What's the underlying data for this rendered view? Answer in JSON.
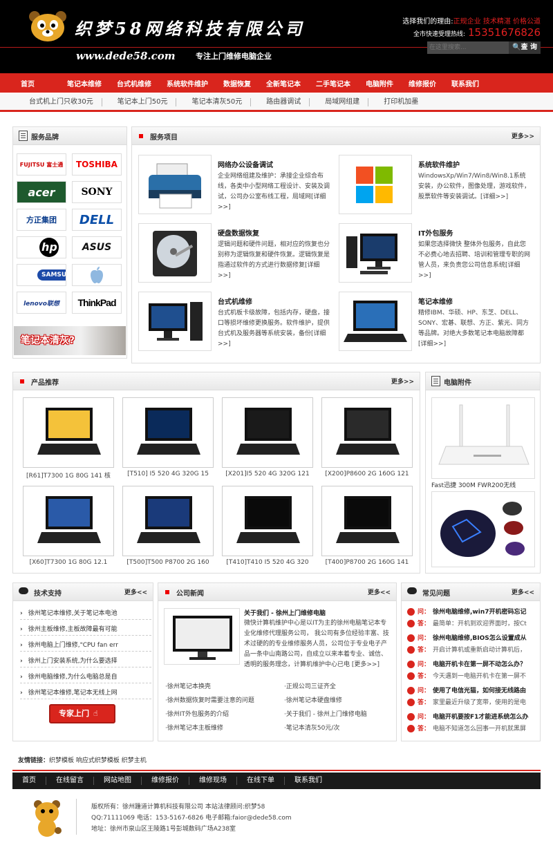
{
  "header": {
    "company": "织梦58网络科技有限公司",
    "url": "www.dede58.com",
    "slogan": "专注上门维修电脑企业",
    "why_label": "选择我们的理由:",
    "why_items": "正规企业 技术精湛 价格公道",
    "hotline_label": "全市快速受理热线:",
    "hotline": "15351676826",
    "search_placeholder": "在这里搜索...",
    "search_button": "查 询"
  },
  "nav": [
    "首页",
    "笔记本维修",
    "台式机维修",
    "系统软件维护",
    "数据恢复",
    "全新笔记本",
    "二手笔记本",
    "电脑附件",
    "维修报价",
    "联系我们"
  ],
  "subnav": [
    "台式机上门只收30元",
    "笔记本上门50元",
    "笔记本清灰50元",
    "路由器调试",
    "局域网组建",
    "打印机加墨"
  ],
  "brands": {
    "title": "服务品牌",
    "items": [
      "FUJITSU 富士通",
      "TOSHIBA",
      "acer",
      "SONY",
      "方正集团",
      "DELL",
      "hp",
      "ASUS",
      "SAMSUNG",
      "Apple",
      "lenovo联想",
      "ThinkPad"
    ],
    "banner": "笔记本清灰?"
  },
  "services": {
    "title": "服务项目",
    "more": "更多>>",
    "items": [
      {
        "title": "网络办公设备调试",
        "desc": "企业网络组建及维护：承接企业综合布线，各类中小型网络工程设计、安装及调试，公司办公室布线工程，局域网[详细>>]"
      },
      {
        "title": "系统软件维护",
        "desc": "WindowsXp/Win7/Win8/Win8.1系统安装，办公软件，图像处理，游戏软件，股票软件等安装调试。[详细>>]"
      },
      {
        "title": "硬盘数据恢复",
        "desc": "逻辑问题和硬件问题，相对应的恢复也分别称为逻辑恢复和硬件恢复。逻辑恢复是指通过软件的方式进行数据修复[详细>>]"
      },
      {
        "title": "IT外包服务",
        "desc": "如果您选择微快 整体外包服务，自此您不必费心地去招聘、培训和管理专职的网管人员，来负责您公司信息系统[详细>>]"
      },
      {
        "title": "台式机维修",
        "desc": "台式机板卡级故障，包括内存，硬盘，接口等损坏维修更换服务。软件维护，提供台式机及服务器等系统安装，备份[详细>>]"
      },
      {
        "title": "笔记本维修",
        "desc": "精修IBM、华硕、HP、东芝、DELL、SONY、宏碁、联想、方正、紫光、同方等品牌。对绝大多数笔记本电脑故障都[详细>>]"
      }
    ]
  },
  "products": {
    "title": "产品推荐",
    "more": "更多>>",
    "items": [
      "[R61]T7300 1G 80G 141 核",
      "[T510] I5 520 4G 320G 15",
      "[X201]I5 520 4G 320G 121",
      "[X200]P8600 2G 160G 121",
      "[X60]T7300 1G 80G 12.1",
      "[T500]T500 P8700 2G 160",
      "[T410]T410 I5 520 4G 320",
      "[T400]P8700 2G 160G 141"
    ]
  },
  "accessories": {
    "title": "电脑附件",
    "caption": "Fast迅捷 300M FWR200无线"
  },
  "tech": {
    "title": "技术支持",
    "more": "更多<<",
    "items": [
      "徐州笔记本维修,关于笔记本电池",
      "徐州主板维修,主板故障最有可能",
      "徐州电脑上门维修,\"CPU fan err",
      "徐州上门安装系统,为什么要选择",
      "徐州电脑维修,为什么电脑总是自",
      "徐州笔记本维修,笔记本无线上网"
    ],
    "button": "专家上门"
  },
  "news": {
    "title": "公司新闻",
    "more": "更多<<",
    "headline": "关于我们 - 徐州上门维修电脑",
    "summary": "微快计算机维护中心是以IT为主的徐州电脑笔记本专业化维修代理服务公司， 我公司有多位经验丰富、技术过硬的的专业维修服务人员，公司位于专业电子产品一条中山南路公司，自成立以来本着专业、诚信、透明的服务理念，计算机维护中心已电 [更多>>]",
    "list": [
      "·徐州笔记本换壳",
      "·正规公司三证齐全",
      "·徐州数据恢复时需要注意的问题",
      "·徐州笔记本硬盘维修",
      "·徐州IT外包服务的介绍",
      "·关于我们 - 徐州上门维修电脑",
      "·徐州笔记本主板维修",
      "·笔记本清灰50元/次"
    ]
  },
  "faq": {
    "title": "常见问题",
    "more": "更多<<",
    "q_label": "问：",
    "a_label": "答：",
    "items": [
      {
        "q": "徐州电脑维修,win7开机密码忘记",
        "a": "最简单：开机到欢迎界面时，按Ct"
      },
      {
        "q": "徐州电脑维修,BIOS怎么设置成从",
        "a": "开启计算机或重新启动计算机后，"
      },
      {
        "q": "电脑开机卡在第一屏不动怎么办？",
        "a": "今天遇到一电脑开机卡在第一屏不"
      },
      {
        "q": "使用了电信光猫，如何接无线路由",
        "a": "家里最近升级了宽带，使用的是电"
      },
      {
        "q": "电脑开机要按F1才能进系统怎么办",
        "a": "电脑不知道怎么回事一开机就黑屏"
      }
    ]
  },
  "links": {
    "label": "友情链接：",
    "items": "织梦模板 响应式织梦模板 织梦主机"
  },
  "footer": {
    "nav": [
      "首页",
      "在线留言",
      "网站地图",
      "维修报价",
      "维修现场",
      "在线下单",
      "联系我们"
    ],
    "line1": "版权所有：徐州踵道计算机科技有限公司 本站法律顾问:织梦58",
    "line2": "QQ:71111069 电话：153-5167-6826 电子邮箱:faior@dede58.com",
    "line3": "地址：徐州市泉山区王陵路1号彭城数码广场A238室"
  },
  "colors": {
    "accent": "#d9251d",
    "header_bg": "#000000"
  }
}
